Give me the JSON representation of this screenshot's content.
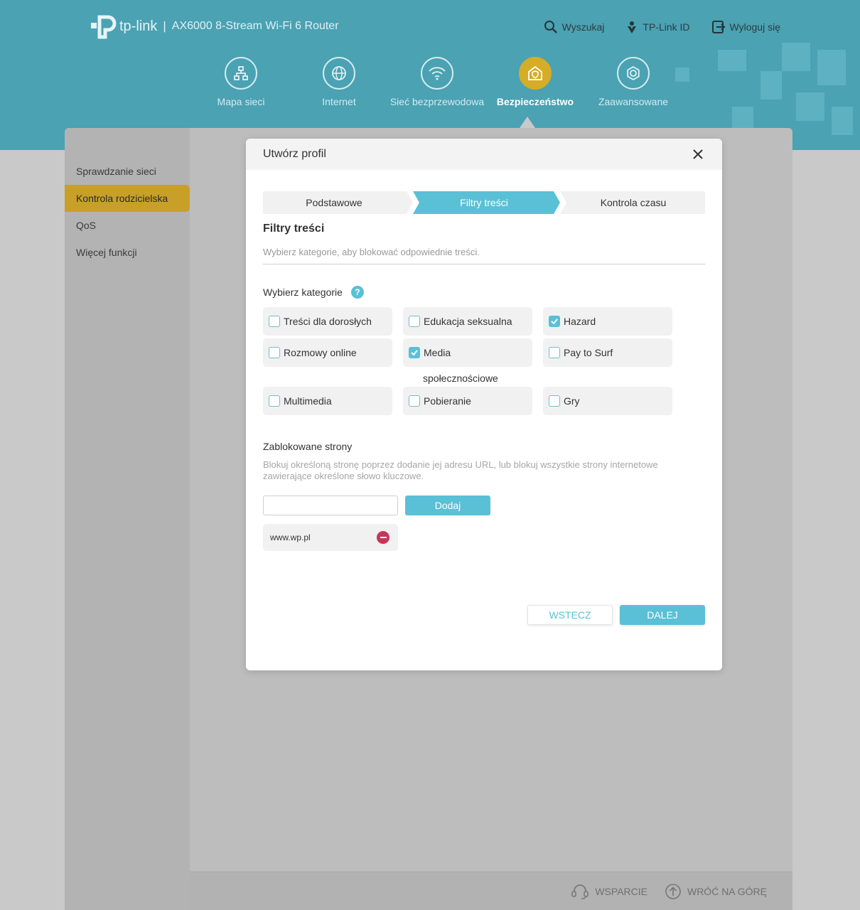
{
  "header": {
    "logo_text": "tp-link",
    "separator": "|",
    "model": "AX6000 8-Stream Wi-Fi 6 Router",
    "top_links": [
      {
        "label": "Wyszukaj",
        "icon": "search-icon"
      },
      {
        "label": "TP-Link ID",
        "icon": "tplink-id-icon"
      },
      {
        "label": "Wyloguj się",
        "icon": "logout-icon"
      }
    ],
    "nav": [
      {
        "label": "Mapa sieci",
        "icon": "network-map-icon"
      },
      {
        "label": "Internet",
        "icon": "globe-icon"
      },
      {
        "label": "Sieć bezprzewodowa",
        "icon": "wifi-icon"
      },
      {
        "label": "Bezpieczeństwo",
        "icon": "security-shield-icon",
        "active": true
      },
      {
        "label": "Zaawansowane",
        "icon": "gear-icon"
      }
    ]
  },
  "sidebar": {
    "items": [
      {
        "label": "Sprawdzanie sieci"
      },
      {
        "label": "Kontrola rodzicielska",
        "active": true
      },
      {
        "label": "QoS"
      },
      {
        "label": "Więcej funkcji"
      }
    ]
  },
  "modal": {
    "title": "Utwórz profil",
    "steps": [
      "Podstawowe",
      "Filtry treści",
      "Kontrola czasu"
    ],
    "active_step": 1,
    "section_title": "Filtry treści",
    "section_desc": "Wybierz kategorie, aby blokować odpowiednie treści.",
    "categories_label": "Wybierz kategorie",
    "help_symbol": "?",
    "categories": [
      {
        "label": "Treści dla dorosłych",
        "checked": false
      },
      {
        "label": "Edukacja seksualna",
        "checked": false
      },
      {
        "label": "Hazard",
        "checked": true
      },
      {
        "label": "Rozmowy online",
        "checked": false
      },
      {
        "label": "Media",
        "label_continued": "społecznościowe",
        "checked": true
      },
      {
        "label": "Pay to Surf",
        "checked": false
      },
      {
        "label": "Multimedia",
        "checked": false
      },
      {
        "label": "Pobieranie",
        "checked": false
      },
      {
        "label": "Gry",
        "checked": false
      }
    ],
    "blocked": {
      "title": "Zablokowane strony",
      "desc": "Blokuj określoną stronę poprzez dodanie jej adresu URL, lub blokuj wszystkie strony internetowe zawierające określone słowo kluczowe.",
      "input_value": "",
      "add_label": "Dodaj",
      "items": [
        "www.wp.pl"
      ]
    },
    "back_label": "WSTECZ",
    "next_label": "DALEJ"
  },
  "footer": {
    "support_label": "WSPARCIE",
    "top_label": "WRÓĆ NA GÓRĘ"
  },
  "colors": {
    "header_bg": "#4aa2b3",
    "accent": "#5ac0d6",
    "active_nav": "#d5ad27",
    "remove": "#c6365a"
  }
}
